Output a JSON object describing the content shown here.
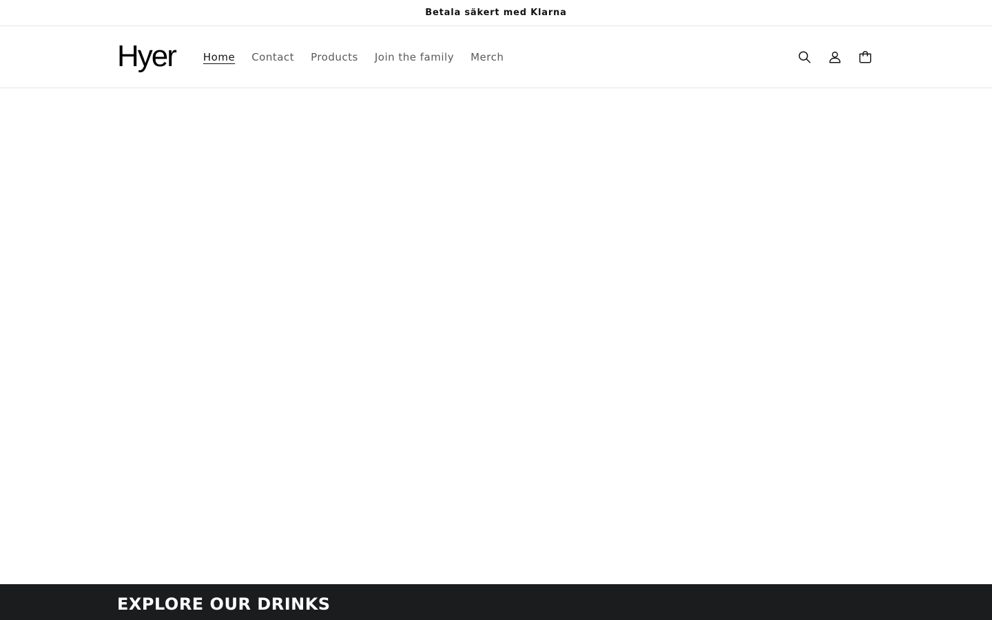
{
  "announcement": {
    "text": "Betala säkert med Klarna"
  },
  "header": {
    "logo_text": "Hyer",
    "nav": [
      {
        "label": "Home",
        "active": true
      },
      {
        "label": "Contact",
        "active": false
      },
      {
        "label": "Products",
        "active": false
      },
      {
        "label": "Join the family",
        "active": false
      },
      {
        "label": "Merch",
        "active": false
      }
    ],
    "icons": [
      "search-icon",
      "account-icon",
      "cart-icon"
    ]
  },
  "drinks_section": {
    "title": "EXPLORE OUR DRINKS"
  },
  "colors": {
    "text": "#121212",
    "nav_inactive": "#5a5a5a",
    "border": "#e6e6e6",
    "dark_band": "#1a1c1e"
  }
}
